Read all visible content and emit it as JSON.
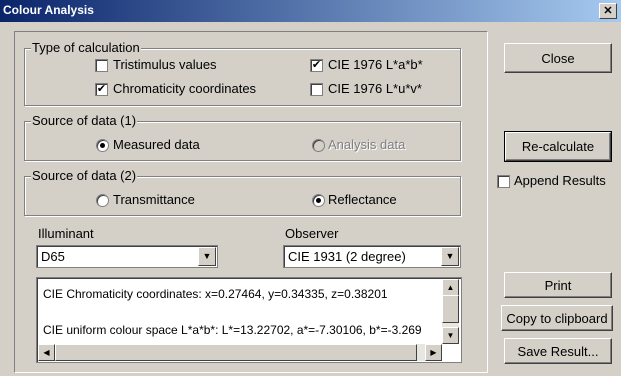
{
  "window": {
    "title": "Colour Analysis",
    "close_glyph": "✕"
  },
  "calc_type": {
    "legend": "Type of calculation",
    "tristimulus": {
      "label": "Tristimulus values",
      "checked": false
    },
    "chromaticity": {
      "label": "Chromaticity coordinates",
      "checked": true
    },
    "cielab": {
      "label": "CIE 1976 L*a*b*",
      "checked": true
    },
    "cieluv": {
      "label": "CIE 1976 L*u*v*",
      "checked": false
    }
  },
  "source1": {
    "legend": "Source of data (1)",
    "measured": {
      "label": "Measured data",
      "selected": true
    },
    "analysis": {
      "label": "Analysis data",
      "selected": false,
      "disabled": true
    }
  },
  "source2": {
    "legend": "Source of data (2)",
    "transmittance": {
      "label": "Transmittance",
      "selected": false
    },
    "reflectance": {
      "label": "Reflectance",
      "selected": true
    }
  },
  "illuminant": {
    "label": "Illuminant",
    "value": "D65"
  },
  "observer": {
    "label": "Observer",
    "value": "CIE 1931 (2 degree)"
  },
  "results": {
    "line1": "CIE Chromaticity coordinates: x=0.27464, y=0.34335, z=0.38201",
    "line2": "CIE uniform colour space L*a*b*: L*=13.22702, a*=-7.30106, b*=-3.269"
  },
  "buttons": {
    "close": "Close",
    "recalculate": "Re-calculate",
    "append": {
      "label": "Append Results",
      "checked": false
    },
    "print": "Print",
    "copy": "Copy to clipboard",
    "save": "Save Result..."
  },
  "glyphs": {
    "check": "✔",
    "down": "▼",
    "up": "▲",
    "left": "◀",
    "right": "▶"
  }
}
